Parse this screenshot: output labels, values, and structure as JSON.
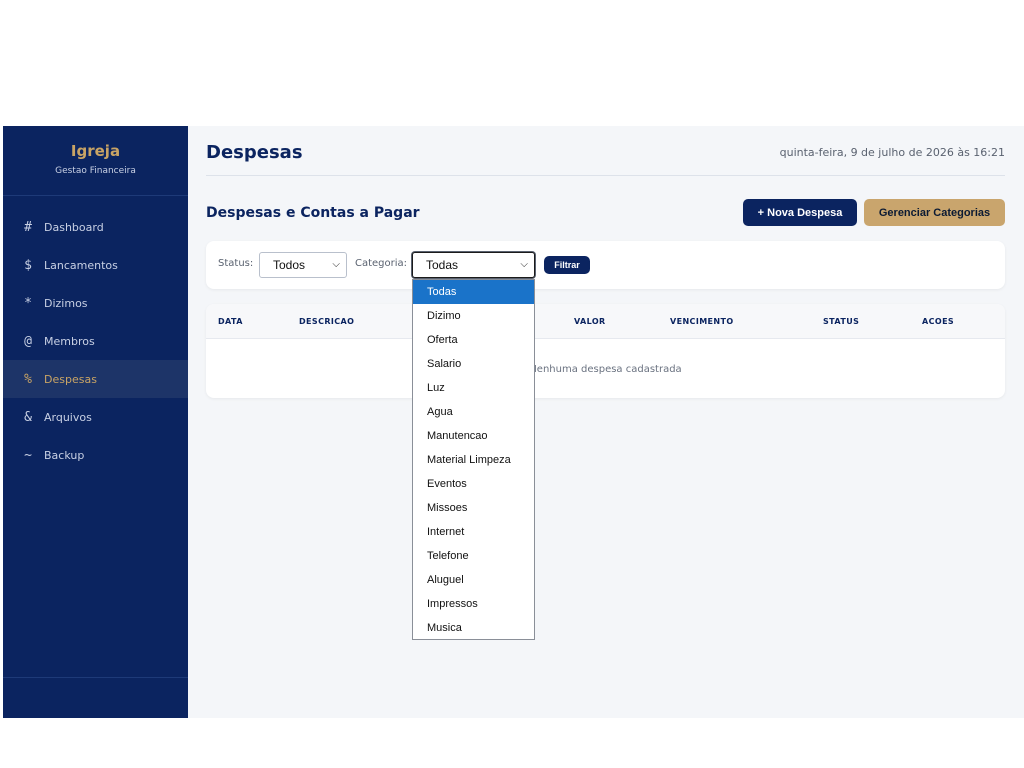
{
  "sidebar": {
    "brand_title": "Igreja",
    "brand_subtitle": "Gestao Financeira",
    "items": [
      {
        "icon": "#",
        "label": "Dashboard"
      },
      {
        "icon": "$",
        "label": "Lancamentos"
      },
      {
        "icon": "*",
        "label": "Dizimos"
      },
      {
        "icon": "@",
        "label": "Membros"
      },
      {
        "icon": "%",
        "label": "Despesas",
        "active": true
      },
      {
        "icon": "&",
        "label": "Arquivos"
      },
      {
        "icon": "~",
        "label": "Backup"
      }
    ]
  },
  "header": {
    "title": "Despesas",
    "datetime": "quinta-feira, 9 de julho de 2026 às 16:21"
  },
  "section": {
    "title": "Despesas e Contas a Pagar",
    "new_button": "+ Nova Despesa",
    "categories_button": "Gerenciar Categorias"
  },
  "filters": {
    "status_label": "Status:",
    "status_value": "Todos",
    "category_label": "Categoria:",
    "category_value": "Todas",
    "filter_button": "Filtrar"
  },
  "table": {
    "columns": [
      "DATA",
      "DESCRICAO",
      "VALOR",
      "VENCIMENTO",
      "STATUS",
      "ACOES"
    ],
    "empty_message": "Nenhuma despesa cadastrada"
  },
  "category_dropdown": {
    "options": [
      "Todas",
      "Dizimo",
      "Oferta",
      "Salario",
      "Luz",
      "Agua",
      "Manutencao",
      "Material Limpeza",
      "Eventos",
      "Missoes",
      "Internet",
      "Telefone",
      "Aluguel",
      "Impressos",
      "Musica"
    ],
    "selected": "Todas"
  },
  "colors": {
    "sidebar_bg": "#0b2460",
    "accent_gold": "#c9a465",
    "primary_navy": "#0b2460",
    "selected_option": "#1a73c9"
  }
}
